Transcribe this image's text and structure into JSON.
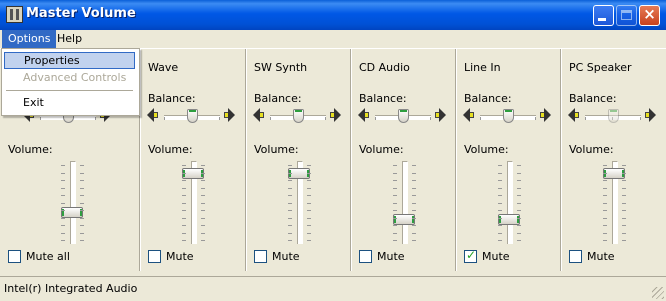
{
  "window": {
    "title": "Master Volume"
  },
  "menubar": {
    "items": [
      "Options",
      "Help"
    ]
  },
  "options_menu": {
    "items": [
      {
        "label": "Properties",
        "highlighted": true,
        "disabled": false
      },
      {
        "label": "Advanced Controls",
        "highlighted": false,
        "disabled": true
      },
      {
        "label": "Exit",
        "highlighted": false,
        "disabled": false
      }
    ]
  },
  "labels": {
    "balance": "Balance:",
    "volume": "Volume:"
  },
  "channels": [
    {
      "name": "",
      "volume": 0.35,
      "balance": 0.5,
      "mute_label": "Mute all",
      "muted": false,
      "balance_enabled": true
    },
    {
      "name": "Wave",
      "volume": 0.9,
      "balance": 0.5,
      "mute_label": "Mute",
      "muted": false,
      "balance_enabled": true
    },
    {
      "name": "SW Synth",
      "volume": 0.9,
      "balance": 0.5,
      "mute_label": "Mute",
      "muted": false,
      "balance_enabled": true
    },
    {
      "name": "CD Audio",
      "volume": 0.25,
      "balance": 0.5,
      "mute_label": "Mute",
      "muted": false,
      "balance_enabled": true
    },
    {
      "name": "Line In",
      "volume": 0.25,
      "balance": 0.5,
      "mute_label": "Mute",
      "muted": true,
      "balance_enabled": true
    },
    {
      "name": "PC Speaker",
      "volume": 0.9,
      "balance": 0.5,
      "mute_label": "Mute",
      "muted": false,
      "balance_enabled": false
    }
  ],
  "statusbar": {
    "text": "Intel(r) Integrated Audio"
  },
  "colors": {
    "titlebar": "#0058E6",
    "face": "#ECE9D8",
    "thumb_accent": "#2E9E40",
    "menu_highlight": "#316AC5"
  }
}
